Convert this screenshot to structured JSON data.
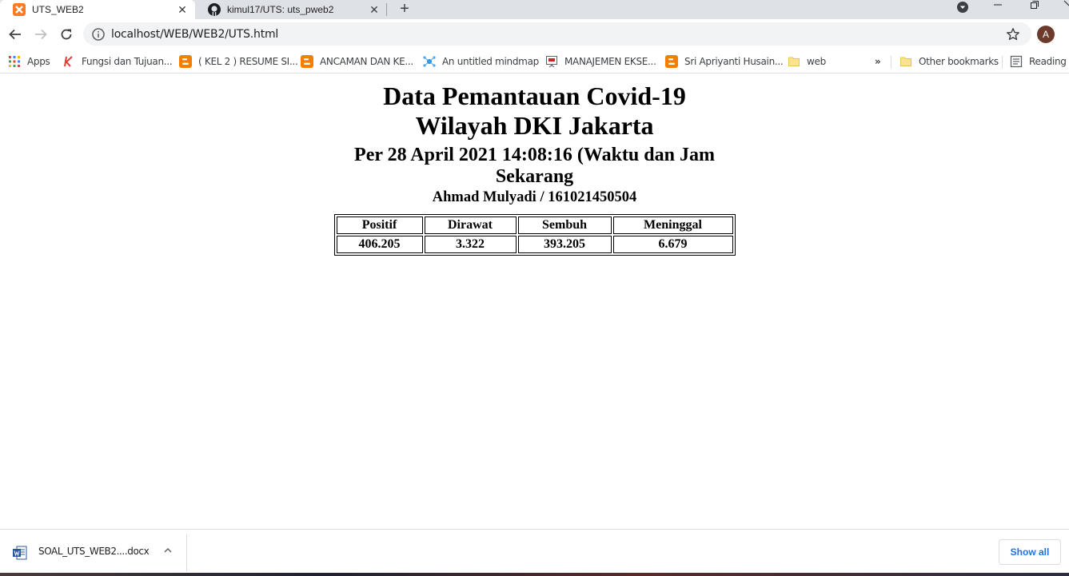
{
  "tabs": [
    {
      "title": "UTS_WEB2",
      "active": true,
      "icon": "xampp-icon"
    },
    {
      "title": "kimul17/UTS: uts_pweb2",
      "active": false,
      "icon": "github-icon"
    }
  ],
  "toolbar": {
    "url": "localhost/WEB/WEB2/UTS.html",
    "avatar_letter": "A"
  },
  "bookmarks": {
    "items": [
      {
        "label": "Apps",
        "icon": "apps-grid-icon"
      },
      {
        "label": "Fungsi dan Tujuan...",
        "icon": "k-logo-icon"
      },
      {
        "label": "( KEL 2 ) RESUME SI...",
        "icon": "blogger-icon"
      },
      {
        "label": "ANCAMAN DAN KE...",
        "icon": "blogger-icon"
      },
      {
        "label": "An untitled mindmap",
        "icon": "mindmap-icon"
      },
      {
        "label": "MANAJEMEN EKSE...",
        "icon": "presentation-icon"
      },
      {
        "label": "Sri Apriyanti Husain...",
        "icon": "blogger-icon"
      },
      {
        "label": "web",
        "icon": "folder-icon"
      }
    ],
    "overflow": "»",
    "other": "Other bookmarks",
    "reading": "Reading li"
  },
  "page": {
    "title_line1": "Data Pemantauan Covid-19",
    "title_line2": "Wilayah DKI Jakarta",
    "subtitle": "Per 28 April 2021 14:08:16 (Waktu dan Jam Sekarang",
    "author": "Ahmad Mulyadi / 161021450504",
    "table": {
      "headers": [
        "Positif",
        "Dirawat",
        "Sembuh",
        "Meninggal"
      ],
      "rows": [
        [
          "406.205",
          "3.322",
          "393.205",
          "6.679"
        ]
      ]
    }
  },
  "downloads": {
    "file_name": "SOAL_UTS_WEB2....docx",
    "show_all": "Show all"
  },
  "colors": {
    "tabstrip": "#dee1e6",
    "omnibox": "#f1f3f4",
    "blogger": "#f57d00",
    "link_blue": "#1a73e8"
  }
}
